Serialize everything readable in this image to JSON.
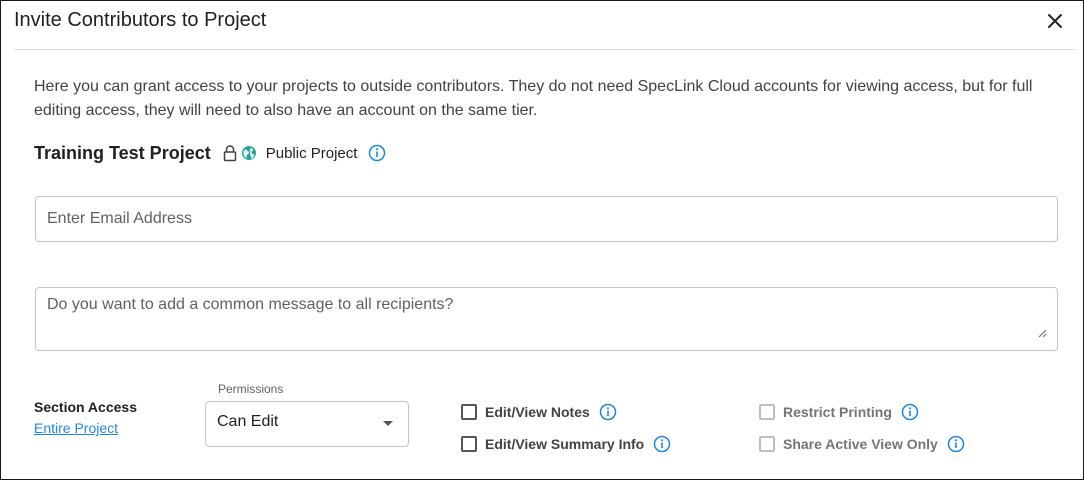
{
  "dialog": {
    "title": "Invite Contributors to Project",
    "close_icon": "close-icon"
  },
  "description": "Here you can grant access to your projects to outside contributors. They do not need SpecLink Cloud accounts for viewing access, but for full editing access, they will need to also have an account on the same tier.",
  "project": {
    "name": "Training Test Project",
    "visibility_label": "Public Project",
    "icons": [
      "lock-icon",
      "globe-icon",
      "info-icon"
    ]
  },
  "email_field": {
    "value": "",
    "placeholder": "Enter Email Address"
  },
  "message_field": {
    "value": "",
    "placeholder": "Do you want to add a common message to all recipients?"
  },
  "section_access": {
    "label": "Section Access",
    "link_text": "Entire Project"
  },
  "permissions": {
    "legend": "Permissions",
    "selected": "Can Edit"
  },
  "options": {
    "edit_view_notes": {
      "label": "Edit/View Notes",
      "checked": false,
      "enabled": true
    },
    "edit_view_summary": {
      "label": "Edit/View Summary Info",
      "checked": false,
      "enabled": true
    },
    "restrict_printing": {
      "label": "Restrict Printing",
      "checked": false,
      "enabled": false
    },
    "share_active_view": {
      "label": "Share Active View Only",
      "checked": false,
      "enabled": false
    }
  },
  "colors": {
    "accent": "#1e88e5",
    "globe": "#26a69a",
    "border": "#c4c4c4"
  }
}
